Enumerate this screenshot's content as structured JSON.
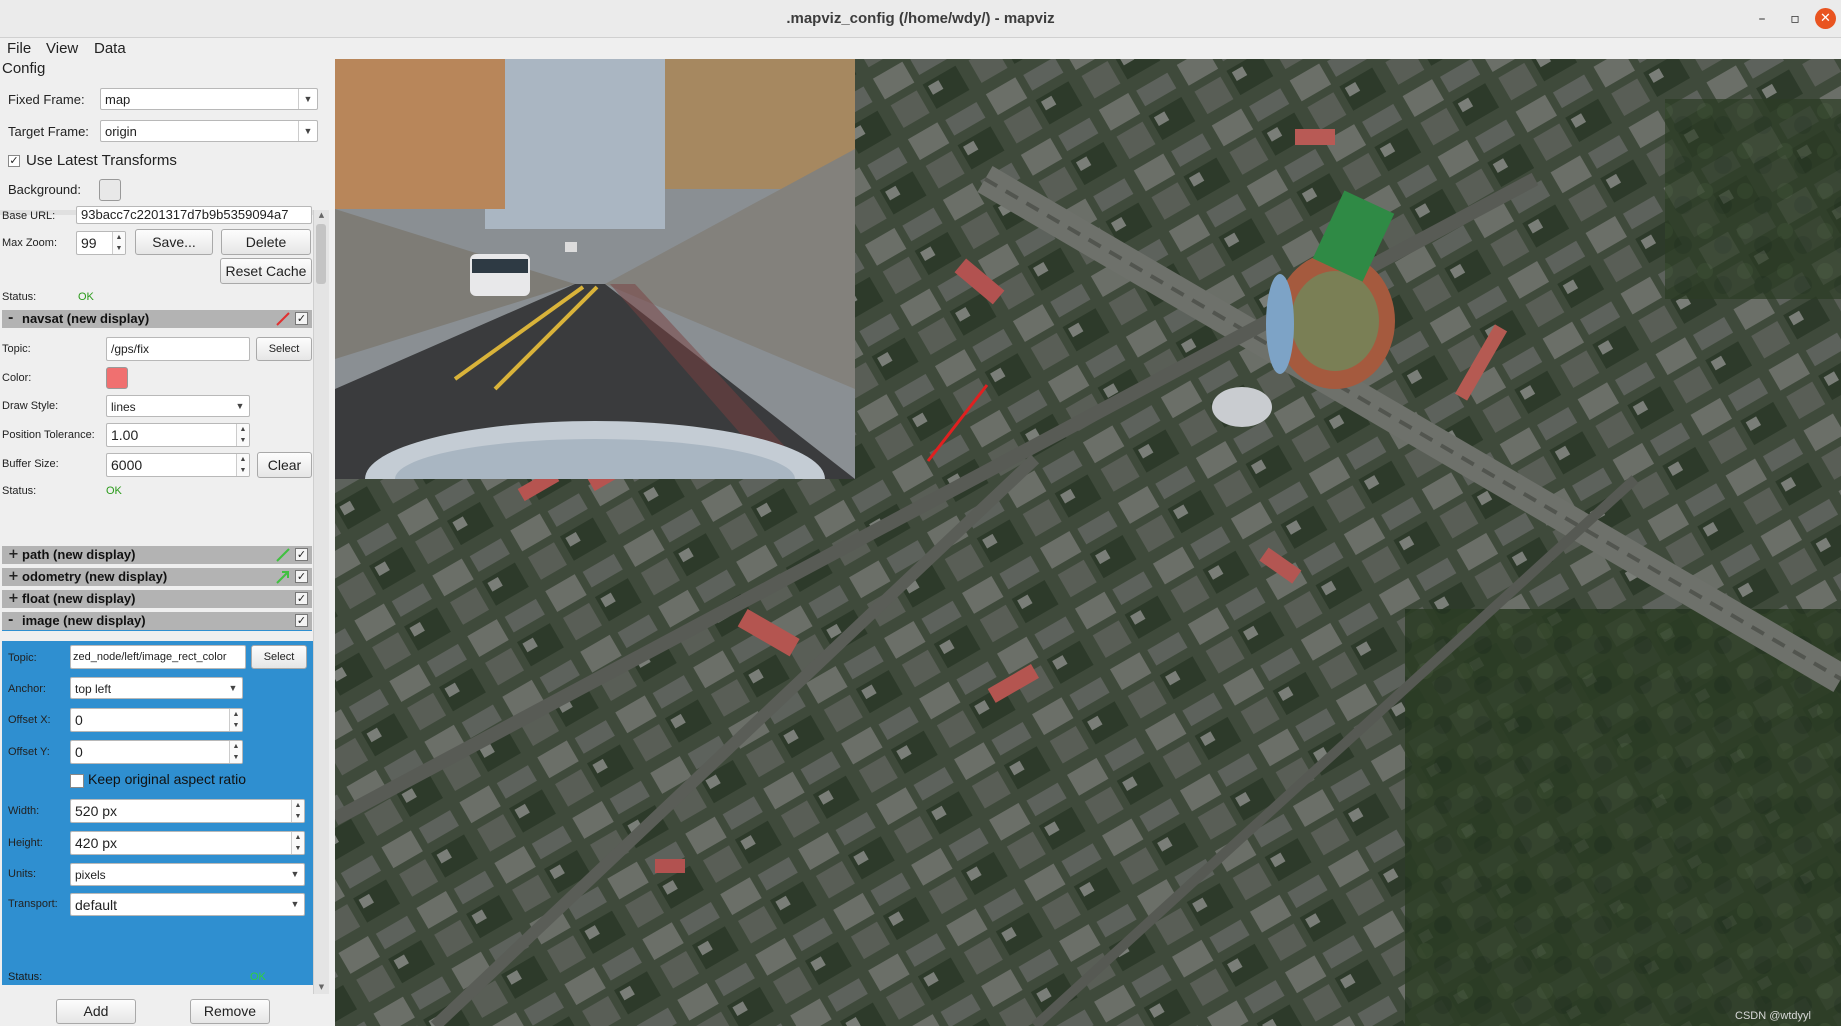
{
  "window": {
    "title": ".mapviz_config (/home/wdy/) - mapviz",
    "controls": {
      "minimize": "–",
      "maximize": "▫",
      "close": "✕"
    }
  },
  "menu": [
    "File",
    "View",
    "Data"
  ],
  "config": {
    "heading": "Config",
    "fixed_frame_label": "Fixed Frame:",
    "fixed_frame_value": "map",
    "target_frame_label": "Target Frame:",
    "target_frame_value": "origin",
    "use_latest_transforms_label": "Use Latest Transforms",
    "use_latest_transforms_checked": true,
    "background_label": "Background:"
  },
  "tile_display": {
    "base_url_label": "Base URL:",
    "base_url_value": "93bacc7c2201317d7b9b5359094a7",
    "max_zoom_label": "Max Zoom:",
    "max_zoom_value": "99",
    "save_button": "Save...",
    "delete_button": "Delete",
    "reset_cache_button": "Reset Cache",
    "status_label": "Status:",
    "status_value": "OK"
  },
  "navsat": {
    "header": "navsat (new display)",
    "expand": "-",
    "pen_color": "#e03030",
    "checked": true,
    "topic_label": "Topic:",
    "topic_value": "/gps/fix",
    "select_button": "Select",
    "color_label": "Color:",
    "color_value": "#f07070",
    "draw_style_label": "Draw Style:",
    "draw_style_value": "lines",
    "position_tolerance_label": "Position Tolerance:",
    "position_tolerance_value": "1.00",
    "buffer_size_label": "Buffer Size:",
    "buffer_size_value": "6000",
    "clear_button": "Clear",
    "status_label": "Status:",
    "status_value": "OK"
  },
  "collapsed_displays": [
    {
      "expand": "+",
      "label": "path (new display)",
      "pen_color": "#40c040",
      "checked": true
    },
    {
      "expand": "+",
      "label": "odometry (new display)",
      "pen_color": "#40c040",
      "checked": true
    },
    {
      "expand": "+",
      "label": "float (new display)",
      "pen_color": "",
      "checked": true
    }
  ],
  "image_display": {
    "header": "image (new display)",
    "expand": "-",
    "checked": true,
    "topic_label": "Topic:",
    "topic_value": "zed_node/left/image_rect_color",
    "select_button": "Select",
    "anchor_label": "Anchor:",
    "anchor_value": "top left",
    "offset_x_label": "Offset X:",
    "offset_x_value": "0",
    "offset_y_label": "Offset Y:",
    "offset_y_value": "0",
    "keep_aspect_label": "Keep original aspect ratio",
    "keep_aspect_checked": false,
    "width_label": "Width:",
    "width_value": "520 px",
    "height_label": "Height:",
    "height_value": "420 px",
    "units_label": "Units:",
    "units_value": "pixels",
    "transport_label": "Transport:",
    "transport_value": "default",
    "status_label": "Status:",
    "status_value": "OK"
  },
  "bottom_buttons": {
    "add": "Add",
    "remove": "Remove"
  },
  "watermark": "CSDN @wtdyyl",
  "colors": {
    "accent_blue": "#2f8fd0",
    "gps_track": "#e02020",
    "status_ok": "#2a9a1a"
  }
}
